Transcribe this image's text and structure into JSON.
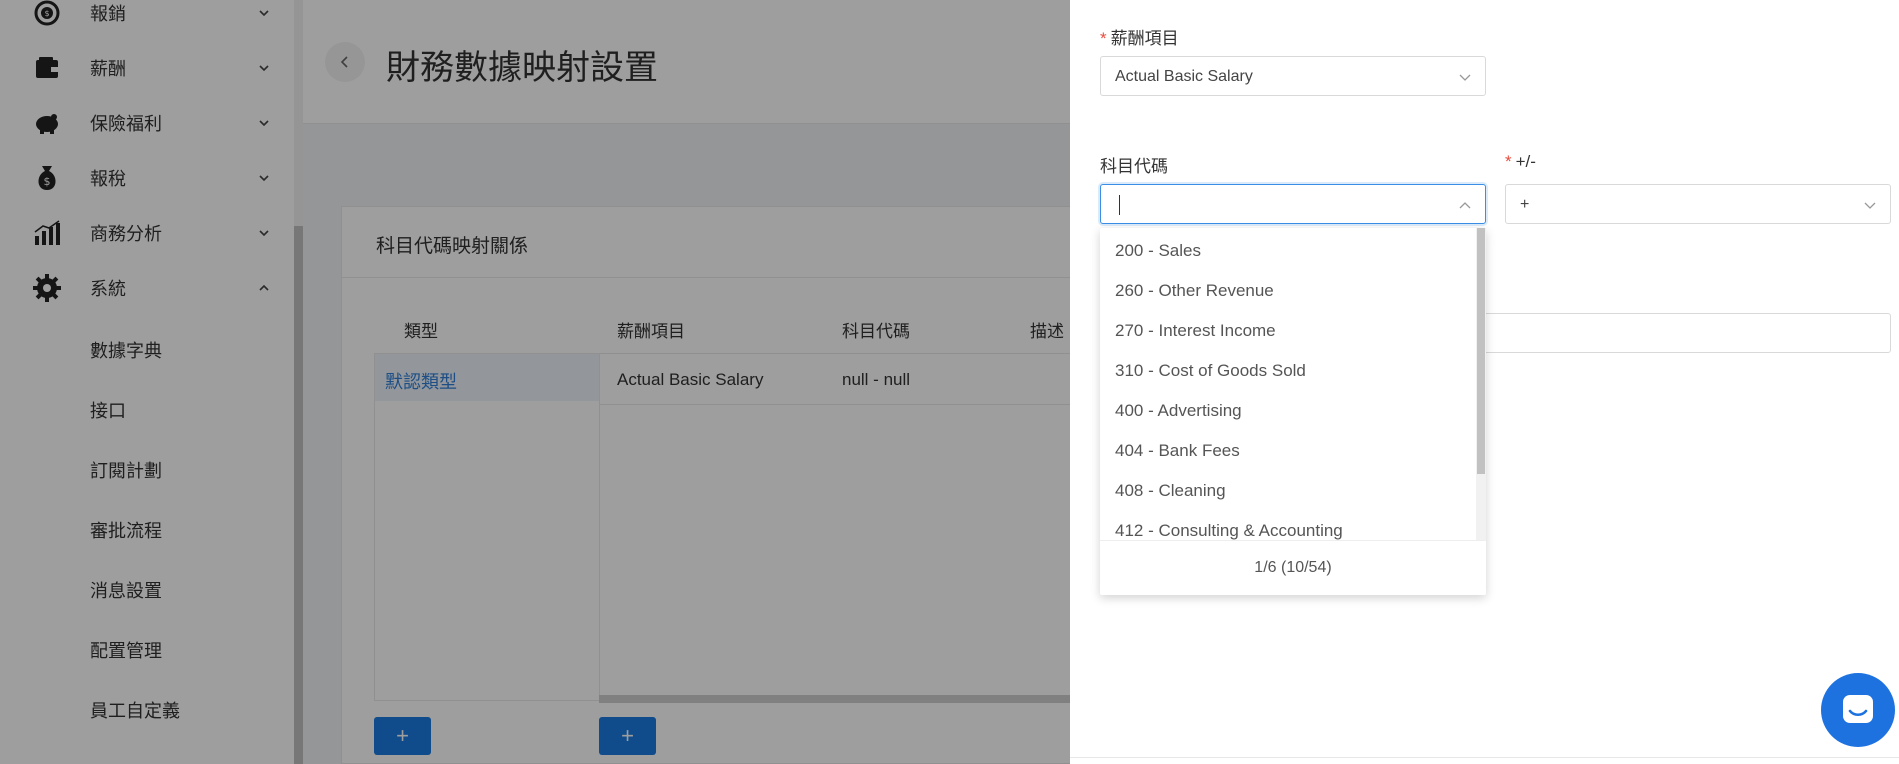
{
  "sidebar": {
    "menu": [
      {
        "label": "報銷",
        "icon": "money-cycle-icon"
      },
      {
        "label": "薪酬",
        "icon": "wallet-icon"
      },
      {
        "label": "保險福利",
        "icon": "piggy-bank-icon"
      },
      {
        "label": "報稅",
        "icon": "money-bag-icon"
      },
      {
        "label": "商務分析",
        "icon": "bar-chart-icon"
      },
      {
        "label": "系統",
        "icon": "gear-icon"
      }
    ],
    "sub_items": [
      "數據字典",
      "接口",
      "訂閱計劃",
      "審批流程",
      "消息設置",
      "配置管理",
      "員工自定義"
    ]
  },
  "header": {
    "title": "財務數據映射設置"
  },
  "card": {
    "title": "科目代碼映射關係",
    "columns": [
      "類型",
      "薪酬項目",
      "科目代碼",
      "描述"
    ],
    "types": [
      "默認類型"
    ],
    "rows": [
      {
        "item": "Actual Basic Salary",
        "code": "null - null"
      }
    ],
    "add_label": "+"
  },
  "drawer": {
    "salary_item_label": "薪酬項目",
    "salary_item_value": "Actual Basic Salary",
    "account_code_label": "科目代碼",
    "sign_label": "+/-",
    "sign_value": "+"
  },
  "dropdown": {
    "options": [
      "200 - Sales",
      "260 - Other Revenue",
      "270 - Interest Income",
      "310 - Cost of Goods Sold",
      "400 - Advertising",
      "404 - Bank Fees",
      "408 - Cleaning",
      "412 - Consulting & Accounting"
    ],
    "pagination": "1/6 (10/54)"
  },
  "colors": {
    "accent": "#1a7ae0",
    "required": "#e74c3c",
    "selected_type": "#2f7fd8"
  }
}
